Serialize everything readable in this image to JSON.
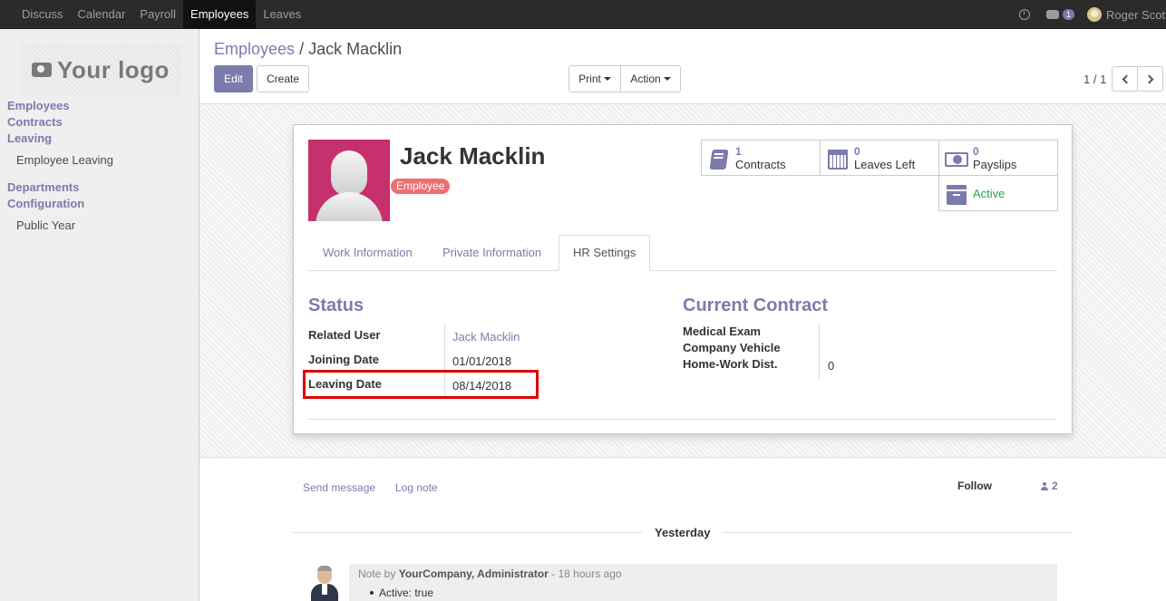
{
  "topbar": {
    "menu": [
      "Discuss",
      "Calendar",
      "Payroll",
      "Employees",
      "Leaves"
    ],
    "active": "Employees",
    "chat_count": "1",
    "user_name": "Roger Scott"
  },
  "sidebar": {
    "logo_text": "Your logo",
    "items": [
      {
        "label": "Employees"
      },
      {
        "label": "Contracts"
      },
      {
        "label": "Leaving"
      },
      {
        "label": "Employee Leaving"
      },
      {
        "label": "Departments"
      },
      {
        "label": "Configuration"
      },
      {
        "label": "Public Year"
      }
    ]
  },
  "breadcrumb": {
    "parent": "Employees",
    "sep": "/",
    "current": "Jack Macklin"
  },
  "buttons": {
    "edit": "Edit",
    "create": "Create",
    "print": "Print",
    "action": "Action"
  },
  "pager": {
    "value": "1 / 1"
  },
  "employee": {
    "name": "Jack Macklin",
    "tag": "Employee",
    "photo_color": "#c6306d"
  },
  "smart_buttons": {
    "contracts": {
      "count": "1",
      "label": "Contracts"
    },
    "leaves": {
      "count": "0",
      "label": "Leaves Left"
    },
    "payslips": {
      "count": "0",
      "label": "Payslips"
    },
    "active": {
      "label": "Active"
    }
  },
  "tabs": [
    "Work Information",
    "Private Information",
    "HR Settings"
  ],
  "active_tab": "HR Settings",
  "status": {
    "title": "Status",
    "fields": [
      {
        "label": "Related User",
        "value": "Jack Macklin"
      },
      {
        "label": "Joining Date",
        "value": "01/01/2018"
      },
      {
        "label": "Leaving Date",
        "value": "08/14/2018"
      }
    ]
  },
  "contract": {
    "title": "Current Contract",
    "fields": [
      {
        "label": "Medical Exam",
        "value": ""
      },
      {
        "label": "Company Vehicle",
        "value": ""
      },
      {
        "label": "Home-Work Dist.",
        "value": "0"
      }
    ]
  },
  "chatter": {
    "send_message": "Send message",
    "log_note": "Log note",
    "follow": "Follow",
    "followers": "2",
    "day": "Yesterday",
    "message": {
      "prefix": "Note by",
      "author": "YourCompany, Administrator",
      "time": "- 18 hours ago",
      "body": "Active: true"
    }
  },
  "colors": {
    "accent": "#7c7bad",
    "highlight": "#e00000",
    "tag": "#ed6f6f",
    "active": "#28a745"
  }
}
